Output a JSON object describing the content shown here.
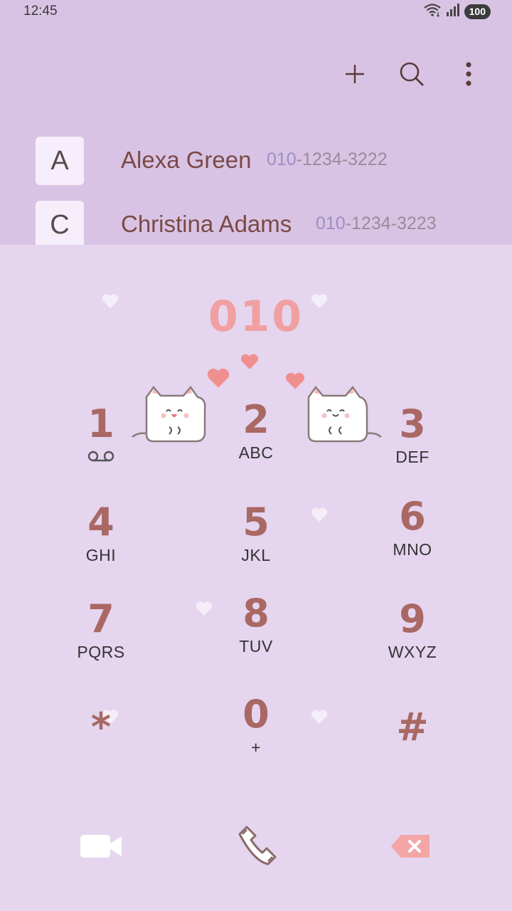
{
  "status": {
    "time": "12:45",
    "battery": "100"
  },
  "toolbar": {
    "add_icon": "plus-icon",
    "search_icon": "search-icon",
    "menu_icon": "more-vert-icon"
  },
  "contacts": [
    {
      "letter": "A",
      "name": "Alexa Green",
      "number_match": "010",
      "number_rest": "-1234-3222"
    },
    {
      "letter": "C",
      "name": "Christina Adams",
      "number_match": "010",
      "number_rest": "-1234-3223"
    }
  ],
  "dialer": {
    "entered": "010",
    "keys": [
      {
        "digit": "1",
        "letters": ""
      },
      {
        "digit": "2",
        "letters": "ABC"
      },
      {
        "digit": "3",
        "letters": "DEF"
      },
      {
        "digit": "4",
        "letters": "GHI"
      },
      {
        "digit": "5",
        "letters": "JKL"
      },
      {
        "digit": "6",
        "letters": "MNO"
      },
      {
        "digit": "7",
        "letters": "PQRS"
      },
      {
        "digit": "8",
        "letters": "TUV"
      },
      {
        "digit": "9",
        "letters": "WXYZ"
      },
      {
        "digit": "*",
        "letters": ""
      },
      {
        "digit": "0",
        "letters": "+"
      },
      {
        "digit": "#",
        "letters": ""
      }
    ],
    "voicemail_icon": "voicemail-icon"
  },
  "bottom": {
    "video_icon": "video-call-icon",
    "call_icon": "phone-call-icon",
    "delete_icon": "backspace-icon"
  },
  "colors": {
    "header_bg": "#d9c3e4",
    "dialpad_bg": "#e5d5ef",
    "digit": "#a96864",
    "entered": "#f0a0a0",
    "heart": "#f08f8f"
  }
}
